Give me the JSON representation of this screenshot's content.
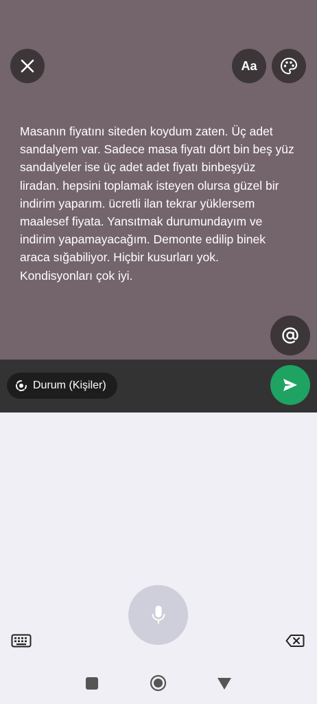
{
  "status": {
    "text": "Masanın fiyatını siteden koydum zaten. Üç adet sandalyem var. Sadece masa fiyatı dört bin beş yüz sandalyeler ise üç adet adet fiyatı binbeşyüz liradan. hepsini toplamak isteyen olursa güzel bir indirim yaparım. ücretli ilan tekrar yüklersem maalesef fiyata. Yansıtmak durumundayım ve indirim yapamayacağım. Demonte edilip binek araca sığabiliyor. Hiçbir kusurları yok. Kondisyonları çok iyi.",
    "background_color": "#74646b"
  },
  "toolbar": {
    "close_icon": "close-icon",
    "font_label": "Aa",
    "palette_icon": "palette-icon",
    "mention_icon": "at-icon"
  },
  "bottom": {
    "audience_label": "Durum (Kişiler)",
    "send_color": "#1ea362"
  },
  "keyboard": {
    "mic_icon": "microphone-icon",
    "keyboard_icon": "keyboard-icon",
    "backspace_icon": "backspace-icon"
  },
  "nav": {
    "recent_icon": "recent-apps-icon",
    "home_icon": "home-icon",
    "back_icon": "back-icon"
  }
}
